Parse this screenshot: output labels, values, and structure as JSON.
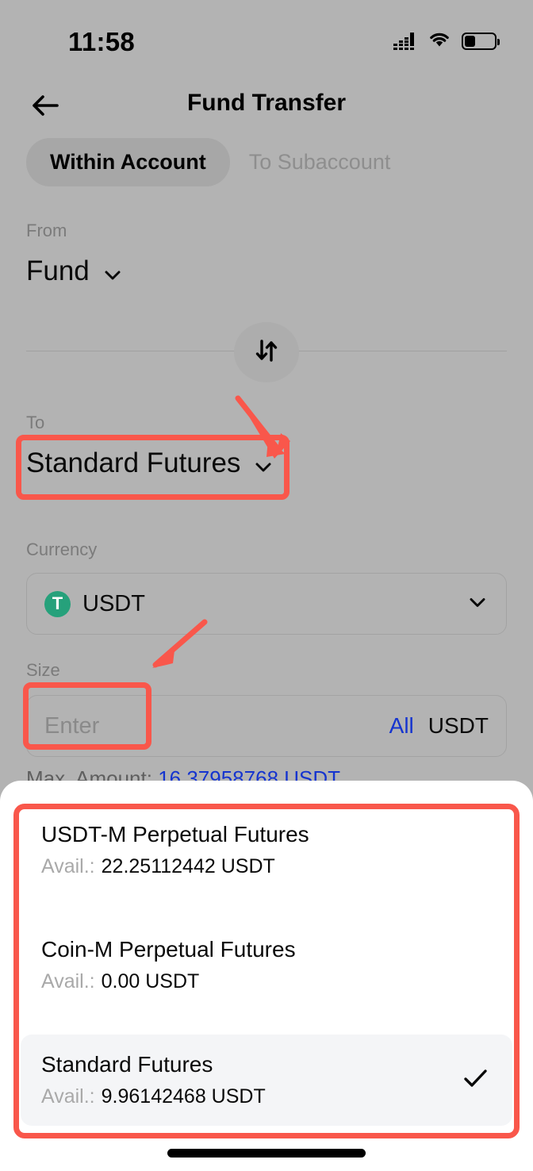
{
  "status_bar": {
    "time": "11:58",
    "signal_icon": "cellular-signal-icon",
    "wifi_icon": "wifi-icon",
    "battery_icon": "battery-low-icon"
  },
  "nav": {
    "back_icon": "back-arrow-icon",
    "title": "Fund Transfer"
  },
  "tabs": [
    {
      "label": "Within Account",
      "active": true
    },
    {
      "label": "To Subaccount",
      "active": false
    }
  ],
  "from": {
    "label": "From",
    "value": "Fund",
    "chevron_icon": "chevron-down-icon"
  },
  "swap": {
    "icon": "swap-vertical-icon"
  },
  "to": {
    "label": "To",
    "value": "Standard Futures",
    "chevron_icon": "chevron-down-icon"
  },
  "currency": {
    "label": "Currency",
    "value": "USDT",
    "coin_symbol": "T",
    "coin_color": "#26a17b",
    "coin_icon": "usdt-tether-icon",
    "chevron_icon": "chevron-down-icon"
  },
  "size": {
    "label": "Size",
    "value": "",
    "placeholder": "Enter",
    "all_label": "All",
    "unit_label": "USDT"
  },
  "max_amount": {
    "label": "Max. Amount:",
    "value": "16.37958768 USDT"
  },
  "sheet": {
    "items": [
      {
        "title": "USDT-M Perpetual Futures",
        "avail_label": "Avail.:",
        "avail_value": "22.25112442 USDT",
        "selected": false
      },
      {
        "title": "Coin-M Perpetual Futures",
        "avail_label": "Avail.:",
        "avail_value": "0.00 USDT",
        "selected": false
      },
      {
        "title": "Standard Futures",
        "avail_label": "Avail.:",
        "avail_value": "9.96142468 USDT",
        "selected": true
      }
    ],
    "check_icon": "checkmark-icon"
  },
  "annotations": {
    "color": "#f9574b",
    "boxes": [
      "to-selector-highlight",
      "size-input-highlight",
      "account-list-highlight"
    ],
    "arrows": [
      "arrow-to-selector",
      "arrow-to-size-input"
    ]
  },
  "colors": {
    "dim_background": "#b3b3b3",
    "sheet_background": "#ffffff",
    "selected_row": "#f4f5f7",
    "link_blue": "#1534cf",
    "annotation_red": "#f9574b"
  },
  "home_indicator": "home-indicator-bar"
}
